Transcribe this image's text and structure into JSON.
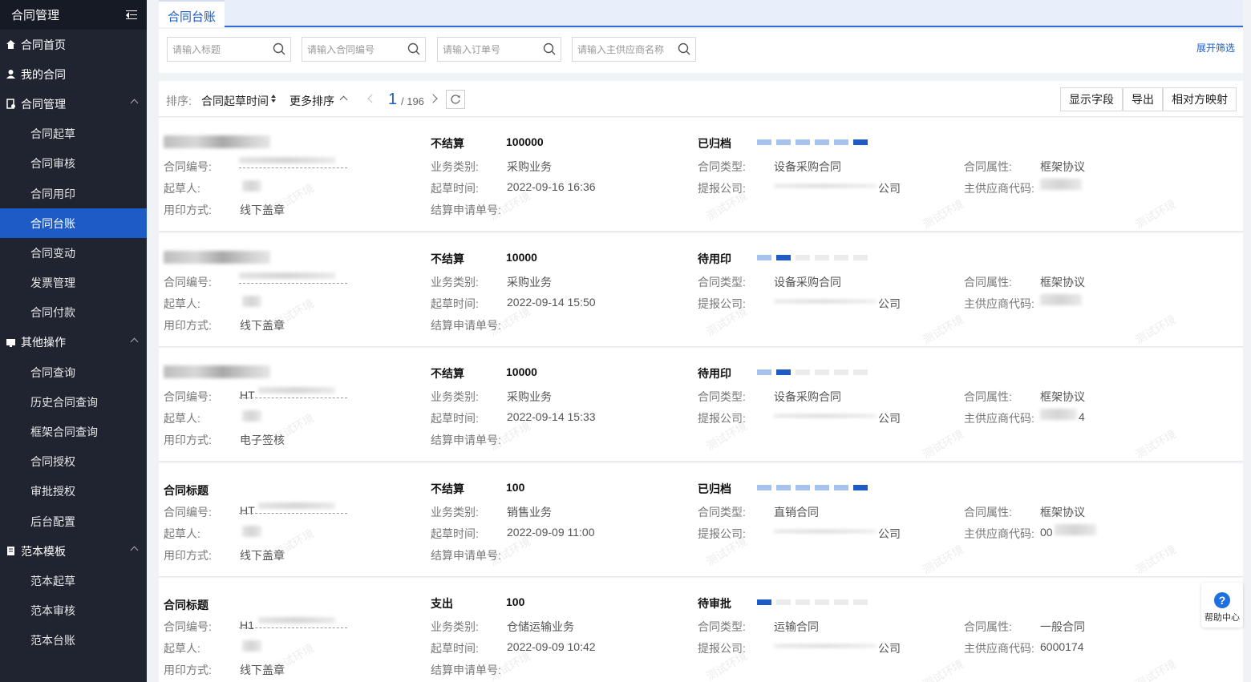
{
  "sidebar": {
    "title": "合同管理",
    "menu": [
      {
        "label": "合同首页",
        "icon": "home-icon",
        "sub": false
      },
      {
        "label": "我的合同",
        "icon": "user-icon",
        "sub": false
      },
      {
        "label": "合同管理",
        "icon": "contract-icon",
        "sub": false,
        "expanded": true
      },
      {
        "label": "合同起草",
        "sub": true
      },
      {
        "label": "合同审核",
        "sub": true
      },
      {
        "label": "合同用印",
        "sub": true
      },
      {
        "label": "合同台账",
        "sub": true,
        "active": true
      },
      {
        "label": "合同变动",
        "sub": true
      },
      {
        "label": "发票管理",
        "sub": true
      },
      {
        "label": "合同付款",
        "sub": true
      },
      {
        "label": "其他操作",
        "icon": "monitor-icon",
        "sub": false,
        "expanded": true
      },
      {
        "label": "合同查询",
        "sub": true
      },
      {
        "label": "历史合同查询",
        "sub": true
      },
      {
        "label": "框架合同查询",
        "sub": true
      },
      {
        "label": "合同授权",
        "sub": true
      },
      {
        "label": "审批授权",
        "sub": true
      },
      {
        "label": "后台配置",
        "sub": true
      },
      {
        "label": "范本模板",
        "icon": "template-icon",
        "sub": false,
        "expanded": true
      },
      {
        "label": "范本起草",
        "sub": true
      },
      {
        "label": "范本审核",
        "sub": true
      },
      {
        "label": "范本台账",
        "sub": true
      }
    ]
  },
  "tab": {
    "label": "合同台账"
  },
  "filters": {
    "title_placeholder": "请输入标题",
    "number_placeholder": "请输入合同编号",
    "order_placeholder": "请输入订单号",
    "supplier_placeholder": "请输入主供应商名称",
    "expand_label": "展开筛选"
  },
  "toolbar": {
    "sort_label": "排序:",
    "sort_field": "合同起草时间",
    "more_sort": "更多排序",
    "page_current": "1",
    "page_total": "/ 196",
    "show_fields": "显示字段",
    "export": "导出",
    "mapping": "相对方映射"
  },
  "labels": {
    "number": "合同编号:",
    "drafter": "起草人:",
    "seal_method": "用印方式:",
    "business_type": "业务类别:",
    "draft_time": "起草时间:",
    "settlement_no": "结算申请单号:",
    "contract_type": "合同类型:",
    "company": "提报公司:",
    "attribute": "合同属性:",
    "supplier_code": "主供应商代码:"
  },
  "records": [
    {
      "title": "",
      "number_prefix": "",
      "seal_method": "线下盖章",
      "settle": "不结算",
      "amount": "100000",
      "business": "采购业务",
      "time": "2022-09-16 16:36",
      "status": "已归档",
      "contract_type": "设备采购合同",
      "company_suffix": "公司",
      "attribute": "框架协议",
      "supplier_code": "",
      "progress": [
        "light",
        "light",
        "light",
        "light",
        "light",
        "dark"
      ]
    },
    {
      "title": "",
      "number_prefix": "",
      "seal_method": "线下盖章",
      "settle": "不结算",
      "amount": "10000",
      "business": "采购业务",
      "time": "2022-09-14 15:50",
      "status": "待用印",
      "contract_type": "设备采购合同",
      "company_suffix": "公司",
      "attribute": "框架协议",
      "supplier_code": "",
      "progress": [
        "light",
        "dark",
        "empty",
        "empty",
        "empty",
        "empty"
      ]
    },
    {
      "title": "",
      "number_prefix": "HT",
      "seal_method": "电子签核",
      "settle": "不结算",
      "amount": "10000",
      "business": "采购业务",
      "time": "2022-09-14 15:33",
      "status": "待用印",
      "contract_type": "设备采购合同",
      "company_suffix": "公司",
      "attribute": "框架协议",
      "supplier_code": "4",
      "progress": [
        "light",
        "dark",
        "empty",
        "empty",
        "empty",
        "empty"
      ]
    },
    {
      "title": "合同标题",
      "number_prefix": "HT",
      "seal_method": "线下盖章",
      "settle": "不结算",
      "amount": "100",
      "business": "销售业务",
      "time": "2022-09-09 11:00",
      "status": "已归档",
      "contract_type": "直销合同",
      "company_suffix": "公司",
      "attribute": "框架协议",
      "supplier_code": "00",
      "progress": [
        "light",
        "light",
        "light",
        "light",
        "light",
        "dark"
      ]
    },
    {
      "title": "合同标题",
      "number_prefix": "H1",
      "seal_method": "线下盖章",
      "settle": "支出",
      "amount": "100",
      "business": "仓储运输业务",
      "time": "2022-09-09 10:42",
      "status": "待审批",
      "contract_type": "运输合同",
      "company_suffix": "公司",
      "attribute": "一般合同",
      "supplier_code": "6000174",
      "progress": [
        "dark",
        "empty",
        "empty",
        "empty",
        "empty",
        "empty"
      ]
    }
  ],
  "watermark": "测试环境",
  "help": {
    "label": "帮助中心",
    "icon": "help-icon"
  }
}
